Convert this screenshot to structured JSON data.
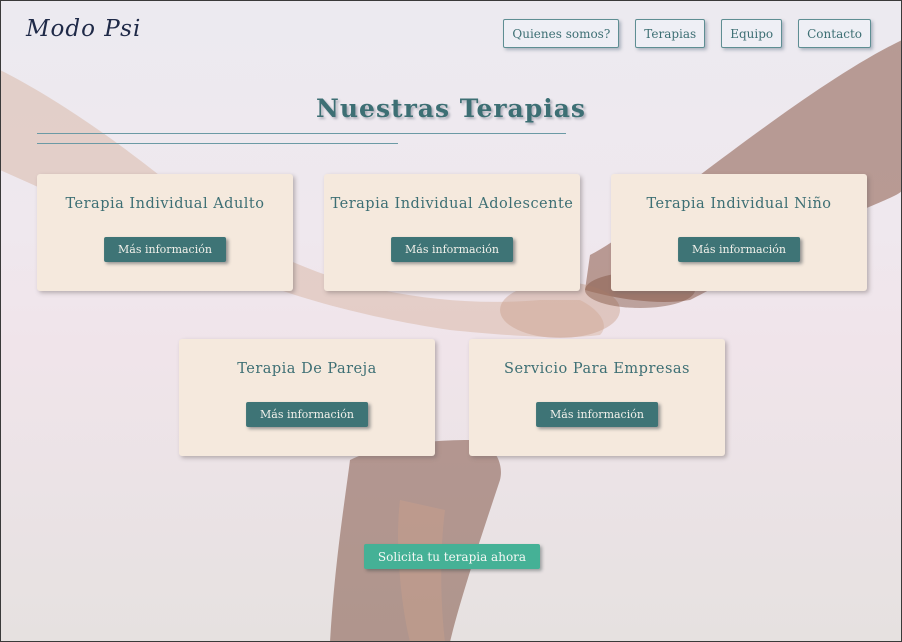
{
  "brand": {
    "logo_text": "Modo Psi"
  },
  "nav": {
    "items": [
      {
        "label": "Quienes somos?"
      },
      {
        "label": "Terapias"
      },
      {
        "label": "Equipo"
      },
      {
        "label": "Contacto"
      }
    ]
  },
  "main": {
    "title": "Nuestras Terapias",
    "cards": [
      {
        "title": "Terapia Individual Adulto",
        "button": "Más información"
      },
      {
        "title": "Terapia Individual Adolescente",
        "button": "Más información"
      },
      {
        "title": "Terapia Individual Niño",
        "button": "Más información"
      },
      {
        "title": "Terapia De Pareja",
        "button": "Más información"
      },
      {
        "title": "Servicio Para Empresas",
        "button": "Más información"
      }
    ],
    "cta_label": "Solicita tu terapia ahora"
  },
  "colors": {
    "accent": "#3d6f74",
    "card_bg": "#f5e9dd",
    "button_bg": "#3e7476",
    "cta_bg": "#45b196"
  }
}
